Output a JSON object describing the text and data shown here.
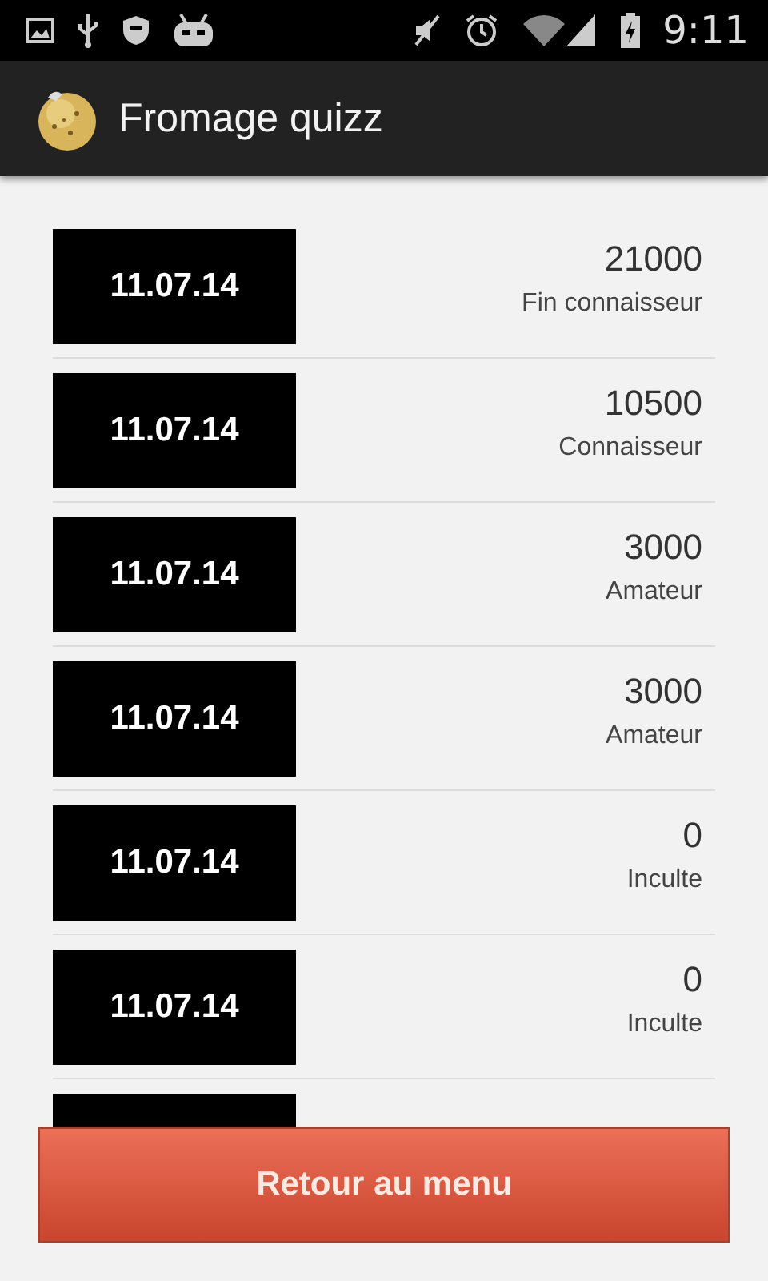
{
  "status_bar": {
    "time": "9:11"
  },
  "app_bar": {
    "title": "Fromage quizz"
  },
  "scores": [
    {
      "date": "11.07.14",
      "score": "21000",
      "rank": "Fin connaisseur"
    },
    {
      "date": "11.07.14",
      "score": "10500",
      "rank": "Connaisseur"
    },
    {
      "date": "11.07.14",
      "score": "3000",
      "rank": "Amateur"
    },
    {
      "date": "11.07.14",
      "score": "3000",
      "rank": "Amateur"
    },
    {
      "date": "11.07.14",
      "score": "0",
      "rank": "Inculte"
    },
    {
      "date": "11.07.14",
      "score": "0",
      "rank": "Inculte"
    }
  ],
  "button": {
    "label": "Retour au menu"
  }
}
